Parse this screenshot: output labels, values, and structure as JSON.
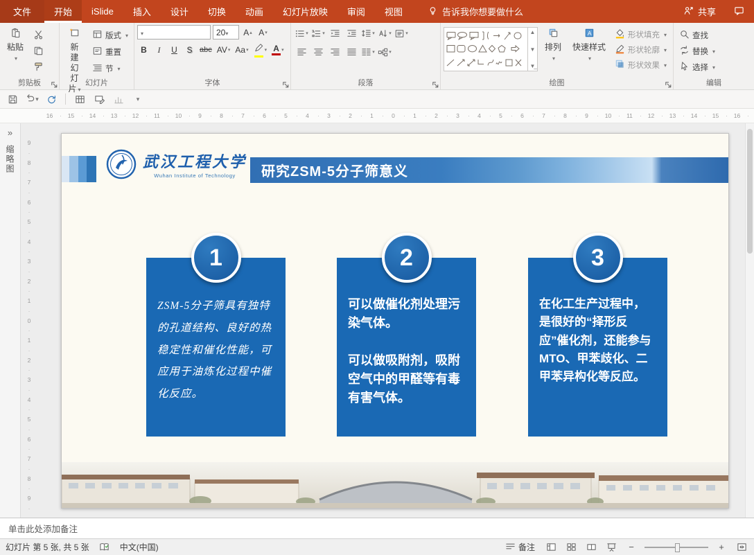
{
  "tabbar": {
    "tabs": [
      {
        "label": "文件",
        "kind": "file"
      },
      {
        "label": "开始",
        "active": true
      },
      {
        "label": "iSlide"
      },
      {
        "label": "插入"
      },
      {
        "label": "设计"
      },
      {
        "label": "切换"
      },
      {
        "label": "动画"
      },
      {
        "label": "幻灯片放映"
      },
      {
        "label": "审阅"
      },
      {
        "label": "视图"
      }
    ],
    "tell_me": "告诉我你想要做什么",
    "share_label": "共享"
  },
  "ribbon": {
    "clipboard": {
      "group_label": "剪贴板",
      "paste_label": "粘贴"
    },
    "slides": {
      "group_label": "幻灯片",
      "new_slide_line1": "新建",
      "new_slide_line2": "幻灯片",
      "layout_label": "版式",
      "reset_label": "重置",
      "section_label": "节"
    },
    "font": {
      "group_label": "字体",
      "font_size_value": "20",
      "grow_label": "A",
      "shrink_label": "A",
      "bold_label": "B",
      "italic_label": "I",
      "underline_label": "U",
      "shadow_label": "S",
      "strike_label": "abc",
      "spacing_label": "AV",
      "case_label": "Aa",
      "color_label": "A"
    },
    "paragraph": {
      "group_label": "段落"
    },
    "drawing": {
      "group_label": "绘图",
      "arrange_label": "排列",
      "quick_styles_label": "快速样式",
      "shape_fill_label": "形状填充",
      "shape_outline_label": "形状轮廓",
      "shape_effects_label": "形状效果"
    },
    "editing": {
      "group_label": "编辑",
      "find_label": "查找",
      "replace_label": "替换",
      "select_label": "选择"
    }
  },
  "thumbnail_pane": {
    "label": "缩略图"
  },
  "rulers": {
    "horizontal": [
      "16",
      "15",
      "14",
      "13",
      "12",
      "11",
      "10",
      "9",
      "8",
      "7",
      "6",
      "5",
      "4",
      "3",
      "2",
      "1",
      "0",
      "1",
      "2",
      "3",
      "4",
      "5",
      "6",
      "7",
      "8",
      "9",
      "10",
      "11",
      "12",
      "13",
      "14",
      "15",
      "16"
    ],
    "vertical": [
      "9",
      "8",
      "7",
      "6",
      "5",
      "4",
      "3",
      "2",
      "1",
      "0",
      "1",
      "2",
      "3",
      "4",
      "5",
      "6",
      "7",
      "8",
      "9"
    ]
  },
  "slide": {
    "logo": {
      "university_cn": "武汉工程大学",
      "university_en": "Wuhan Institute of Technology"
    },
    "title": "研究ZSM-5分子筛意义",
    "cards": [
      {
        "number": "1",
        "text": "ZSM-5分子筛具有独特的孔道结构、良好的热稳定性和催化性能，可应用于油炼化过程中催化反应。"
      },
      {
        "number": "2",
        "text": "可以做催化剂处理污染气体。\n\n可以做吸附剂，吸附空气中的甲醛等有毒有害气体。"
      },
      {
        "number": "3",
        "text": "在化工生产过程中，是很好的“择形反应”催化剂，还能参与MTO、甲苯歧化、二甲苯异构化等反应。"
      }
    ]
  },
  "notes": {
    "placeholder": "单击此处添加备注"
  },
  "statusbar": {
    "slide_info": "幻灯片 第 5 张, 共 5 张",
    "language": "中文(中国)",
    "notes_button": "备注"
  },
  "colors": {
    "accent": "#C2451E",
    "card_blue": "#1A69B4",
    "banner_blue": "#2E75B6"
  }
}
